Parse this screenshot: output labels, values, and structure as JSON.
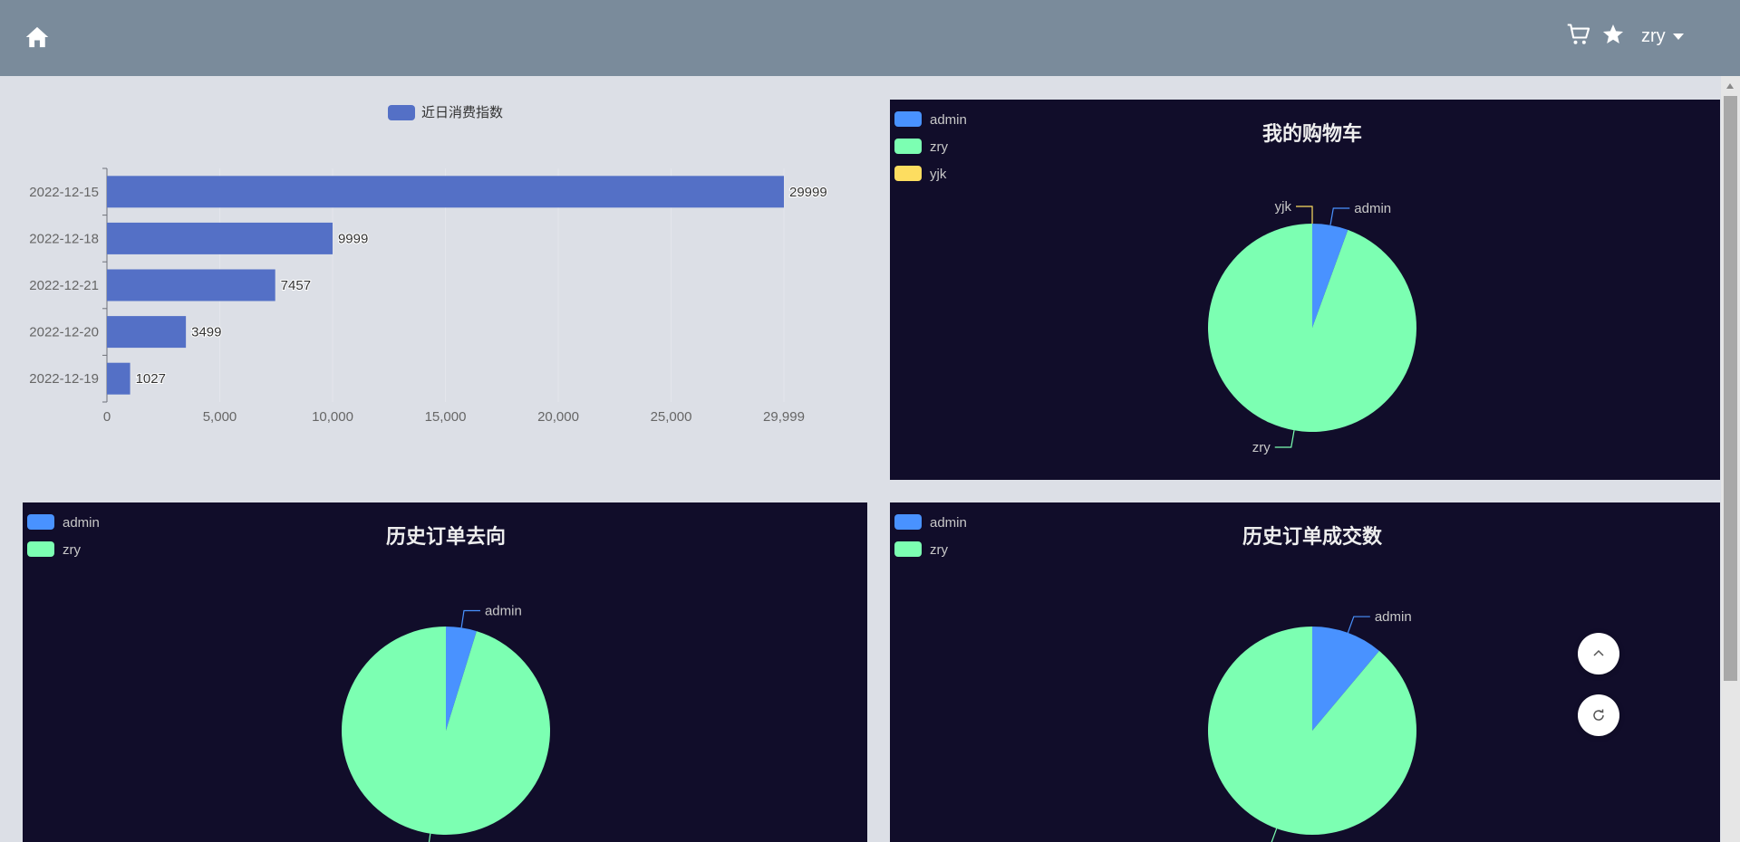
{
  "header": {
    "username": "zry",
    "icons": [
      "home-icon",
      "cart-icon",
      "star-icon",
      "caret-down-icon"
    ]
  },
  "colors": {
    "topbar": "#7a8b9b",
    "page_bg": "#dcdfe6",
    "dark_panel": "#110d2a",
    "bar": "#5470c6",
    "admin": "#4992ff",
    "zry": "#7cffb2",
    "yjk": "#fddd60"
  },
  "float_buttons": [
    "scroll-top-icon",
    "refresh-icon"
  ],
  "chart_data": [
    {
      "type": "bar",
      "orientation": "horizontal",
      "legend": [
        "近日消费指数"
      ],
      "categories": [
        "2022-12-15",
        "2022-12-18",
        "2022-12-21",
        "2022-12-20",
        "2022-12-19"
      ],
      "series": [
        {
          "name": "近日消费指数",
          "values": [
            29999,
            9999,
            7457,
            3499,
            1027
          ]
        }
      ],
      "xlim": [
        0,
        29999
      ],
      "xticks": [
        "0",
        "5,000",
        "10,000",
        "15,000",
        "20,000",
        "25,000",
        "29,999"
      ],
      "grid": true,
      "legend_position": "top-center"
    },
    {
      "type": "pie",
      "title": "我的购物车",
      "legend": [
        "admin",
        "zry",
        "yjk"
      ],
      "legend_position": "top-left",
      "slices": [
        {
          "name": "admin",
          "value": 1
        },
        {
          "name": "zry",
          "value": 17
        },
        {
          "name": "yjk",
          "value": 0
        }
      ]
    },
    {
      "type": "pie",
      "title": "历史订单去向",
      "legend": [
        "admin",
        "zry"
      ],
      "legend_position": "top-left",
      "slices": [
        {
          "name": "admin",
          "value": 1
        },
        {
          "name": "zry",
          "value": 20
        }
      ]
    },
    {
      "type": "pie",
      "title": "历史订单成交数",
      "legend": [
        "admin",
        "zry"
      ],
      "legend_position": "top-left",
      "slices": [
        {
          "name": "admin",
          "value": 1
        },
        {
          "name": "zry",
          "value": 8
        }
      ]
    }
  ]
}
